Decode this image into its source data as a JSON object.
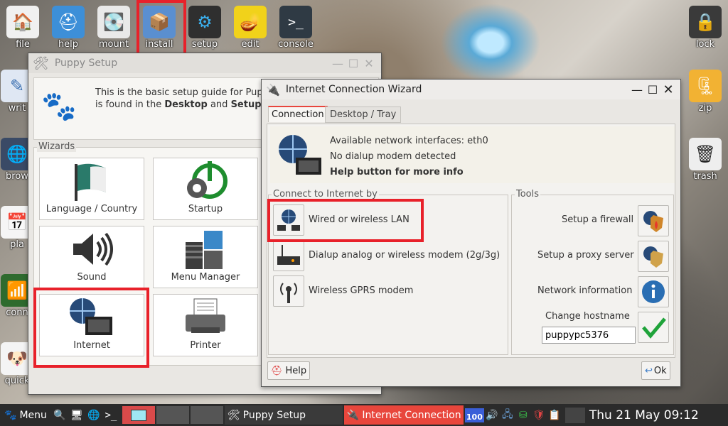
{
  "desktop_icons": {
    "file": "file",
    "help": "help",
    "mount": "mount",
    "install": "install",
    "setup": "setup",
    "edit": "edit",
    "console": "console",
    "lock": "lock",
    "zip": "zip",
    "trash": "trash",
    "writ": "writ",
    "brow": "brow",
    "pla": "pla",
    "conn": "conn",
    "quick": "quick"
  },
  "puppy_setup": {
    "title": "Puppy Setup",
    "intro_line1": "This is the basic setup guide for Pup",
    "intro_line2_pre": "is found in the ",
    "intro_bold1": "Desktop",
    "intro_and": " and ",
    "intro_bold2": "Setup",
    "wizards_label": "Wizards",
    "tiles": [
      "Language / Country",
      "Startup",
      "Sound",
      "Menu Manager",
      "Internet",
      "Printer"
    ]
  },
  "wizard": {
    "title": "Internet Connection Wizard",
    "tabs": [
      "Connection",
      "Desktop / Tray"
    ],
    "info_line1": "Available network interfaces: eth0",
    "info_line2": "No dialup modem detected",
    "info_line3": "Help button for more info",
    "connect_label": "Connect to Internet by",
    "options": [
      "Wired or wireless LAN",
      "Dialup analog or wireless modem (2g/3g)",
      "Wireless GPRS modem"
    ],
    "tools_label": "Tools",
    "tools": [
      "Setup a firewall",
      "Setup a proxy server",
      "Network information"
    ],
    "hostname_label": "Change hostname",
    "hostname_value": "puppypc5376",
    "help_button": "Help",
    "ok_button": "Ok"
  },
  "taskbar": {
    "menu": "Menu",
    "task1": "Puppy Setup",
    "task2": "Internet Connection W",
    "volume": "100",
    "clock": "Thu 21 May 09:12"
  },
  "colors": {
    "highlight": "#e8212a",
    "tab_active": "#e8463c"
  }
}
